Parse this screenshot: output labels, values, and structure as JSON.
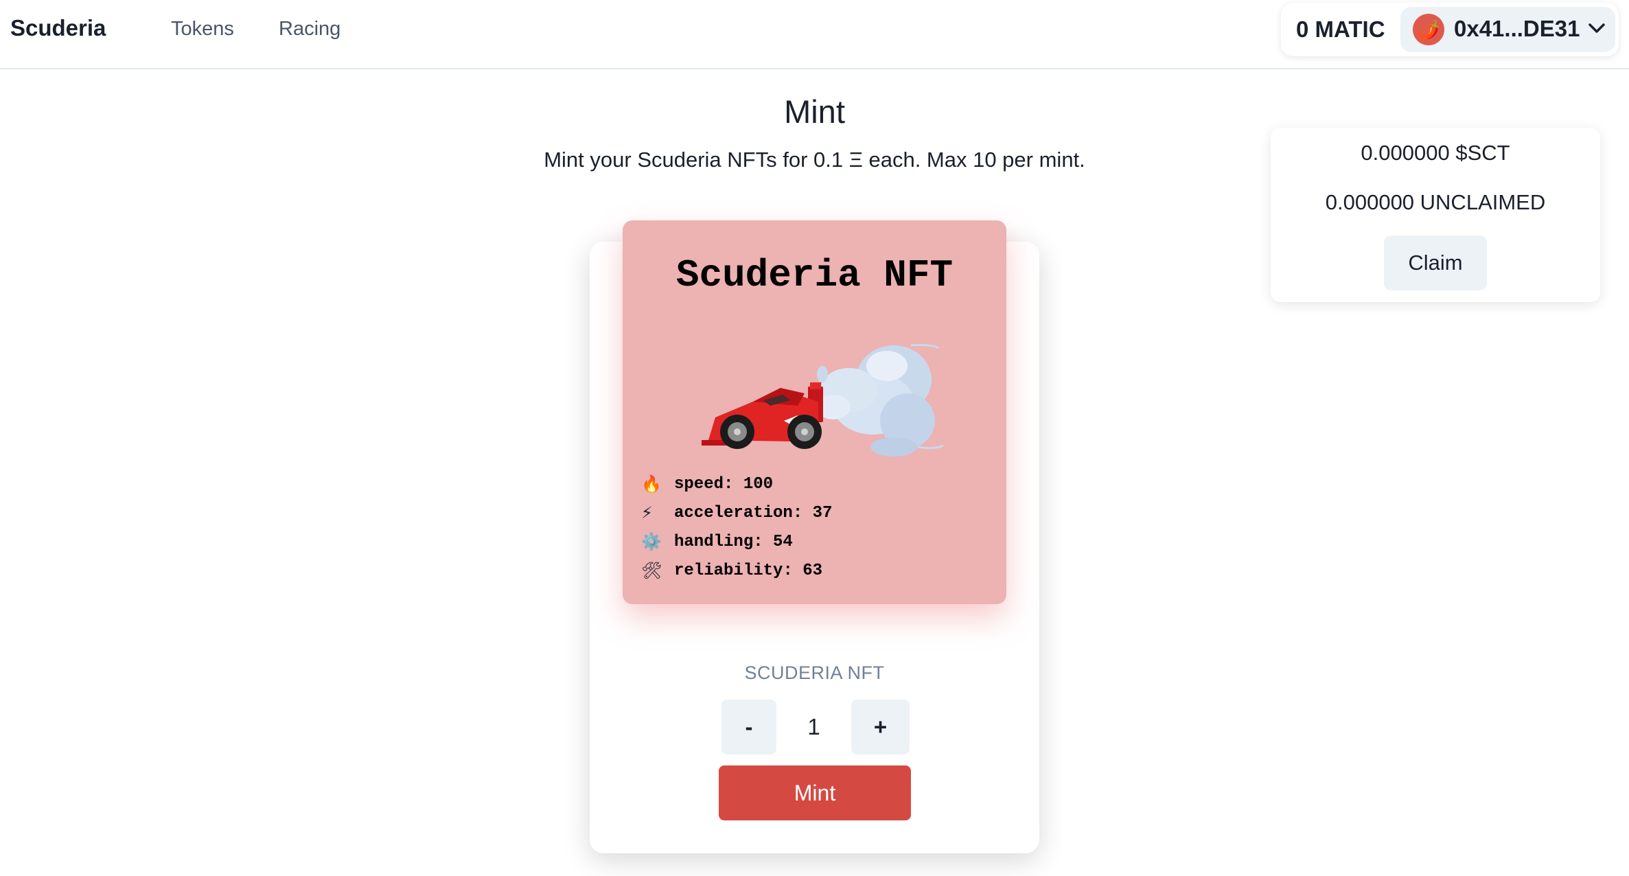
{
  "nav": {
    "brand": "Scuderia",
    "links": [
      {
        "label": "Tokens"
      },
      {
        "label": "Racing"
      }
    ]
  },
  "wallet": {
    "balance": "0 MATIC",
    "avatar_emoji": "🌶️",
    "address": "0x41...DE31",
    "chevron_icon": "chevron-down"
  },
  "tokens": {
    "sct_balance": "0.000000 $SCT",
    "unclaimed": "0.000000 UNCLAIMED",
    "claim_label": "Claim"
  },
  "page": {
    "title": "Mint",
    "subtitle": "Mint your Scuderia NFTs for 0.1 Ξ each. Max 10 per mint."
  },
  "nft": {
    "title": "Scuderia NFT",
    "background_color": "#edb2b2",
    "stats": [
      {
        "icon": "🔥",
        "name": "speed",
        "value": "100"
      },
      {
        "icon": "⚡",
        "name": "acceleration",
        "value": "37"
      },
      {
        "icon": "⚙️",
        "name": "handling",
        "value": "54"
      },
      {
        "icon": "🛠",
        "name": "reliability",
        "value": "63"
      }
    ]
  },
  "mint": {
    "collection_label": "SCUDERIA NFT",
    "minus_label": "-",
    "quantity": "1",
    "plus_label": "+",
    "mint_label": "Mint",
    "accent_color": "#d44a42"
  }
}
